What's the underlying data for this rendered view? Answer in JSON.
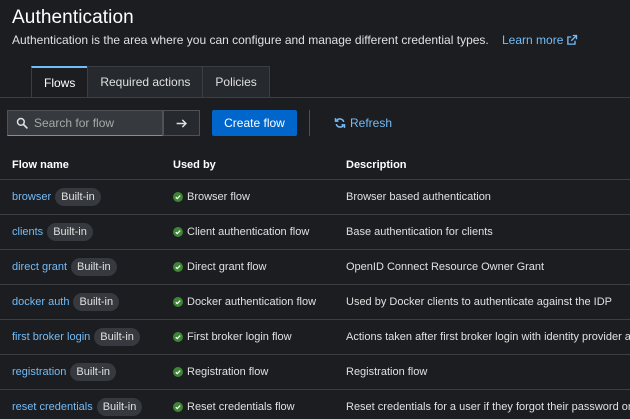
{
  "header": {
    "title": "Authentication",
    "description": "Authentication is the area where you can configure and manage different credential types.",
    "learn_more": "Learn more"
  },
  "tabs": [
    {
      "label": "Flows",
      "active": true
    },
    {
      "label": "Required actions",
      "active": false
    },
    {
      "label": "Policies",
      "active": false
    }
  ],
  "toolbar": {
    "search_placeholder": "Search for flow",
    "create_label": "Create flow",
    "refresh_label": "Refresh"
  },
  "table": {
    "columns": [
      "Flow name",
      "Used by",
      "Description"
    ],
    "rows": [
      {
        "name": "browser",
        "badge": "Built-in",
        "used_by": "Browser flow",
        "description": "Browser based authentication"
      },
      {
        "name": "clients",
        "badge": "Built-in",
        "used_by": "Client authentication flow",
        "description": "Base authentication for clients"
      },
      {
        "name": "direct grant",
        "badge": "Built-in",
        "used_by": "Direct grant flow",
        "description": "OpenID Connect Resource Owner Grant"
      },
      {
        "name": "docker auth",
        "badge": "Built-in",
        "used_by": "Docker authentication flow",
        "description": "Used by Docker clients to authenticate against the IDP"
      },
      {
        "name": "first broker login",
        "badge": "Built-in",
        "used_by": "First broker login flow",
        "description": "Actions taken after first broker login with identity provider account"
      },
      {
        "name": "registration",
        "badge": "Built-in",
        "used_by": "Registration flow",
        "description": "Registration flow"
      },
      {
        "name": "reset credentials",
        "badge": "Built-in",
        "used_by": "Reset credentials flow",
        "description": "Reset credentials for a user if they forgot their password or something"
      }
    ]
  },
  "colors": {
    "background": "#1b1d21",
    "link": "#73bcf7",
    "primary": "#0066cc",
    "success": "#3e8635"
  },
  "icons": {
    "search": "search-icon",
    "arrow": "arrow-right-icon",
    "refresh": "refresh-icon",
    "external": "external-link-icon",
    "check": "check-circle-icon"
  }
}
